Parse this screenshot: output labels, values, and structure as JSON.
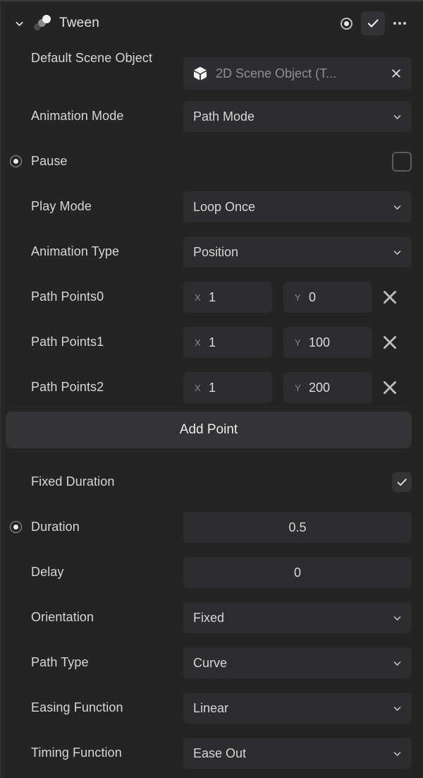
{
  "panel": {
    "title": "Tween",
    "icon": "tween-motion-icon",
    "collapse_icon": "chevron-down-icon",
    "actions": [
      {
        "name": "record-keyframe-button",
        "icon": "record-icon",
        "active": false
      },
      {
        "name": "enable-toggle-button",
        "icon": "check-icon",
        "active": true
      },
      {
        "name": "more-options-button",
        "icon": "ellipsis-icon",
        "active": false
      }
    ]
  },
  "fields": {
    "default_scene_object": {
      "label": "Default Scene Object",
      "value": "2D Scene Object (T...",
      "object_icon": "cube-icon",
      "clear_icon": "close-icon"
    },
    "animation_mode": {
      "label": "Animation Mode",
      "value": "Path Mode"
    },
    "pause": {
      "label": "Pause",
      "checked": false,
      "keyframe": true
    },
    "play_mode": {
      "label": "Play Mode",
      "value": "Loop Once"
    },
    "animation_type": {
      "label": "Animation Type",
      "value": "Position"
    },
    "fixed_duration": {
      "label": "Fixed Duration",
      "checked": true
    },
    "duration": {
      "label": "Duration",
      "value": "0.5",
      "keyframe": true
    },
    "delay": {
      "label": "Delay",
      "value": "0"
    },
    "orientation": {
      "label": "Orientation",
      "value": "Fixed"
    },
    "path_type": {
      "label": "Path Type",
      "value": "Curve"
    },
    "easing_function": {
      "label": "Easing Function",
      "value": "Linear"
    },
    "timing_function": {
      "label": "Timing Function",
      "value": "Ease Out"
    }
  },
  "path_points": {
    "x_axis_label": "X",
    "y_axis_label": "Y",
    "remove_icon": "close-icon",
    "items": [
      {
        "label": "Path Points0",
        "x": "1",
        "y": "0"
      },
      {
        "label": "Path Points1",
        "x": "1",
        "y": "100"
      },
      {
        "label": "Path Points2",
        "x": "1",
        "y": "200"
      }
    ]
  },
  "add_point_button": {
    "label": "Add Point"
  },
  "colors": {
    "panel_bg": "#242425",
    "field_bg": "#2d2d2f",
    "button_bg": "#333335",
    "text": "#d6d6d7",
    "muted_text": "#8f8f91",
    "border": "#3a3a3c"
  }
}
